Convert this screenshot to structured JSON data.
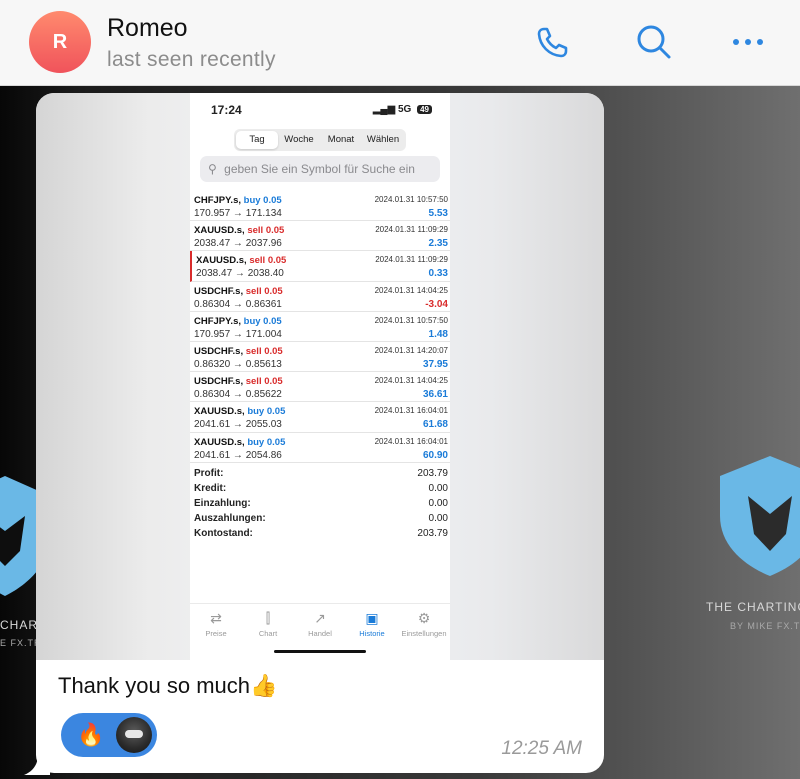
{
  "header": {
    "avatar_letter": "R",
    "name": "Romeo",
    "status": "last seen recently"
  },
  "watermark": {
    "left_text": "CHARTING",
    "left_sub": "E FX.TRA",
    "right_text": "THE CHARTING",
    "right_sub": "BY MIKE FX.TRA"
  },
  "phone": {
    "time": "17:24",
    "network": "5G",
    "battery": "49",
    "segments": [
      {
        "label": "Tag",
        "active": true
      },
      {
        "label": "Woche"
      },
      {
        "label": "Monat"
      },
      {
        "label": "Wählen"
      }
    ],
    "search_placeholder": "geben Sie ein Symbol für Suche ein",
    "trades": [
      {
        "symbol": "CHFJPY.s,",
        "side": "buy 0.05",
        "prices": "170.957 → 171.134",
        "date": "2024.01.31 10:57:50",
        "pl": "5.53"
      },
      {
        "symbol": "XAUUSD.s,",
        "side": "sell 0.05",
        "prices": "2038.47 → 2037.96",
        "date": "2024.01.31 11:09:29",
        "pl": "2.35"
      },
      {
        "symbol": "XAUUSD.s,",
        "side": "sell 0.05",
        "prices": "2038.47 → 2038.40",
        "date": "2024.01.31 11:09:29",
        "pl": "0.33"
      },
      {
        "symbol": "USDCHF.s,",
        "side": "sell 0.05",
        "prices": "0.86304 → 0.86361",
        "date": "2024.01.31 14:04:25",
        "pl": "-3.04"
      },
      {
        "symbol": "CHFJPY.s,",
        "side": "buy 0.05",
        "prices": "170.957 → 171.004",
        "date": "2024.01.31 10:57:50",
        "pl": "1.48"
      },
      {
        "symbol": "USDCHF.s,",
        "side": "sell 0.05",
        "prices": "0.86320 → 0.85613",
        "date": "2024.01.31 14:20:07",
        "pl": "37.95"
      },
      {
        "symbol": "USDCHF.s,",
        "side": "sell 0.05",
        "prices": "0.86304 → 0.85622",
        "date": "2024.01.31 14:04:25",
        "pl": "36.61"
      },
      {
        "symbol": "XAUUSD.s,",
        "side": "buy 0.05",
        "prices": "2041.61 → 2055.03",
        "date": "2024.01.31 16:04:01",
        "pl": "61.68"
      },
      {
        "symbol": "XAUUSD.s,",
        "side": "buy 0.05",
        "prices": "2041.61 → 2054.86",
        "date": "2024.01.31 16:04:01",
        "pl": "60.90"
      }
    ],
    "summary": [
      {
        "label": "Profit:",
        "value": "203.79"
      },
      {
        "label": "Kredit:",
        "value": "0.00"
      },
      {
        "label": "Einzahlung:",
        "value": "0.00"
      },
      {
        "label": "Auszahlungen:",
        "value": "0.00"
      },
      {
        "label": "Kontostand:",
        "value": "203.79"
      }
    ],
    "tabs": [
      {
        "label": "Preise",
        "icon": "prices-icon"
      },
      {
        "label": "Chart",
        "icon": "chart-icon"
      },
      {
        "label": "Handel",
        "icon": "trade-icon"
      },
      {
        "label": "Historie",
        "icon": "history-icon",
        "active": true
      },
      {
        "label": "Einstellungen",
        "icon": "settings-icon"
      }
    ]
  },
  "message": {
    "caption": "Thank you so much👍",
    "reaction_emoji": "🔥",
    "time": "12:25 AM"
  },
  "colors": {
    "accent": "#3b86e0",
    "buy": "#1a7bd8",
    "sell": "#d92b2b"
  }
}
